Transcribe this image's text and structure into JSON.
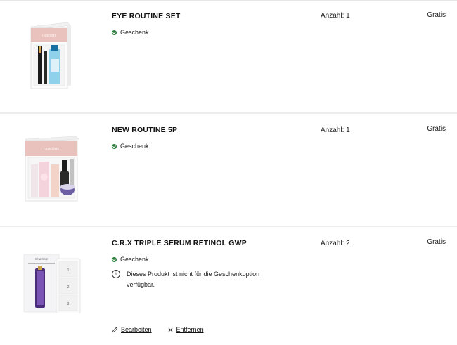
{
  "items": [
    {
      "name": "EYE ROUTINE SET",
      "gift_label": "Geschenk",
      "quantity": "Anzahl: 1",
      "price": "Gratis",
      "brand": "LANCÔME"
    },
    {
      "name": "NEW ROUTINE 5P",
      "gift_label": "Geschenk",
      "quantity": "Anzahl: 1",
      "price": "Gratis",
      "brand": "LANCÔME"
    },
    {
      "name": "C.R.X TRIPLE SERUM RETINOL GWP",
      "gift_label": "Geschenk",
      "quantity": "Anzahl: 2",
      "price": "Gratis",
      "notice": "Dieses Produkt ist nicht für die Geschenkoption verfügbar.",
      "edit_label": "Bearbeiten",
      "remove_label": "Entfernen",
      "brand": "RÉNERGIE"
    }
  ],
  "colors": {
    "gift_check": "#2d7f3e",
    "divider": "#ececec",
    "box_pink": "#e9c2bd"
  },
  "icons": [
    "check-icon",
    "info-icon",
    "pencil-icon",
    "close-icon"
  ]
}
